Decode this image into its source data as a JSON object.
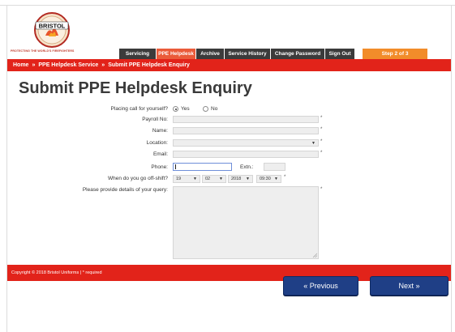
{
  "brand": {
    "logo_text": "BRISTOL",
    "tagline": "PROTECTING THE WORLD'S FIREFIGHTERS"
  },
  "nav": {
    "items": [
      {
        "label": "Servicing",
        "active": false
      },
      {
        "label": "PPE Helpdesk",
        "active": true
      },
      {
        "label": "Archive",
        "active": false
      },
      {
        "label": "Service History",
        "active": false
      },
      {
        "label": "Change Password",
        "active": false
      },
      {
        "label": "Sign Out",
        "active": false
      }
    ],
    "step": "Step 2 of 3"
  },
  "breadcrumb": {
    "home": "Home",
    "sep": "»",
    "section": "PPE Helpdesk Service",
    "current": "Submit PPE Helpdesk Enquiry"
  },
  "page_title": "Submit PPE Helpdesk Enquiry",
  "form": {
    "self_call_label": "Placing call for yourself?",
    "yes": "Yes",
    "no": "No",
    "self_call_value": "Yes",
    "payroll_label": "Payroll No:",
    "name_label": "Name:",
    "location_label": "Location:",
    "email_label": "Email:",
    "phone_label": "Phone:",
    "extn_label": "Extn.:",
    "offshift_label": "When do you go off-shift?",
    "offshift_day": "19",
    "offshift_month": "02",
    "offshift_year": "2018",
    "offshift_time": "09:30",
    "details_label": "Please provide details of your query:",
    "required_mark": "*",
    "payroll_value": "",
    "name_value": "",
    "location_value": "",
    "email_value": "",
    "phone_value": "",
    "extn_value": "",
    "details_value": ""
  },
  "footer": {
    "copyright": "Copyright © 2018 Bristol Uniforms  |  * required"
  },
  "buttons": {
    "previous": "« Previous",
    "next": "Next »"
  },
  "colors": {
    "brand_red": "#e2231a",
    "nav_dark": "#3b3b3b",
    "nav_active": "#ea5b3a",
    "step_orange": "#f28c2a",
    "button_blue": "#1f3f86"
  }
}
